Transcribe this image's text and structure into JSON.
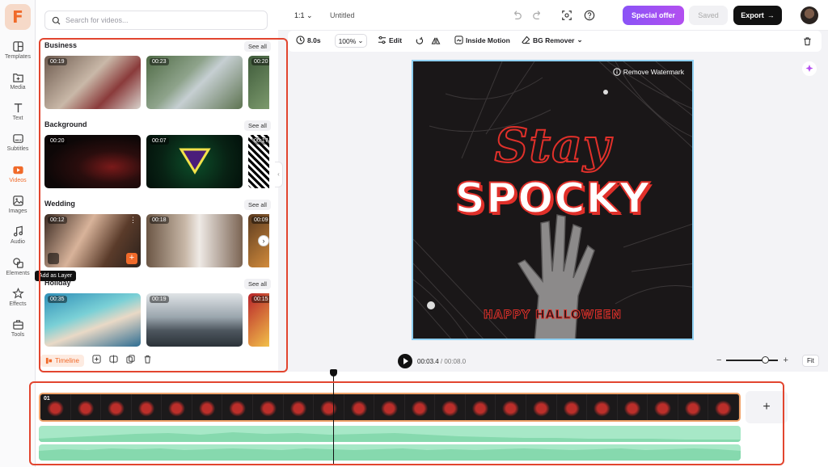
{
  "app": {
    "logo_letter": "F",
    "accent": "#f06a2a"
  },
  "sidebar": {
    "items": [
      {
        "label": "Templates",
        "icon": "templates-icon"
      },
      {
        "label": "Media",
        "icon": "media-icon"
      },
      {
        "label": "Text",
        "icon": "text-icon"
      },
      {
        "label": "Subtitles",
        "icon": "subtitles-icon"
      },
      {
        "label": "Videos",
        "icon": "videos-icon",
        "active": true
      },
      {
        "label": "Images",
        "icon": "images-icon"
      },
      {
        "label": "Audio",
        "icon": "audio-icon"
      },
      {
        "label": "Elements",
        "icon": "elements-icon"
      },
      {
        "label": "Effects",
        "icon": "effects-icon"
      },
      {
        "label": "Tools",
        "icon": "tools-icon"
      }
    ]
  },
  "search": {
    "placeholder": "Search for videos..."
  },
  "library": {
    "see_all": "See all",
    "sections": [
      {
        "title": "Business",
        "durations": [
          "00:19",
          "00:23",
          "00:20"
        ]
      },
      {
        "title": "Background",
        "durations": [
          "00:20",
          "00:07",
          "00:17"
        ]
      },
      {
        "title": "Wedding",
        "durations": [
          "00:12",
          "00:18",
          "00:09"
        ]
      },
      {
        "title": "Holiday",
        "durations": [
          "00:35",
          "00:19",
          "00:15"
        ]
      }
    ],
    "tooltip": "Add as Layer"
  },
  "panel_bottom": {
    "timeline_label": "Timeline"
  },
  "topbar": {
    "ratio": "1:1",
    "title": "Untitled",
    "special_offer": "Special offer",
    "saved": "Saved",
    "export": "Export"
  },
  "edit_toolbar": {
    "duration": "8.0s",
    "zoom": "100%",
    "edit": "Edit",
    "inside_motion": "Inside Motion",
    "bg_remover": "BG Remover"
  },
  "canvas": {
    "remove_watermark": "Remove Watermark",
    "line1": "Stay",
    "line2": "SPOCKY",
    "line3": "HAPPY HALLOWEEN"
  },
  "playback": {
    "current": "00:03.4",
    "separator": " / ",
    "total": "00:08.0",
    "fit": "Fit"
  },
  "timeline": {
    "clip_label": "01"
  }
}
